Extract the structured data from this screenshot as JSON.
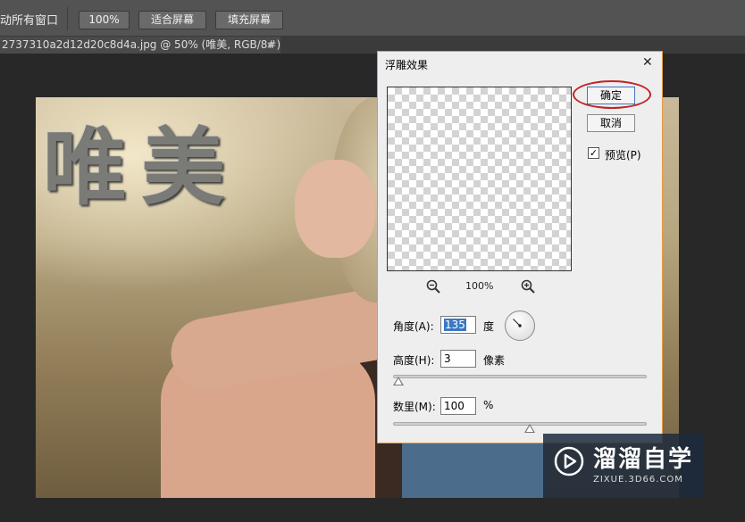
{
  "toolbar": {
    "partial_label": "动所有窗口",
    "zoom_100_label": "100%",
    "fit_screen_label": "适合屏幕",
    "fill_screen_label": "填充屏幕"
  },
  "document_tab": {
    "title": "2737310a2d12d20c8d4a.jpg @ 50% (唯美, RGB/8#) *",
    "close_glyph": "×"
  },
  "canvas": {
    "embossed_text": "唯美"
  },
  "dialog": {
    "title": "浮雕效果",
    "close_glyph": "✕",
    "ok_label": "确定",
    "cancel_label": "取消",
    "preview_checked": true,
    "preview_check_glyph": "✓",
    "preview_label": "预览(P)",
    "zoom_level": "100%",
    "angle_label": "角度(A):",
    "angle_value": "135",
    "angle_unit": "度",
    "height_label": "高度(H):",
    "height_value": "3",
    "height_unit": "像素",
    "amount_label": "数里(M):",
    "amount_value": "100",
    "amount_unit": "%",
    "height_slider_fraction": 0.02,
    "amount_slider_fraction": 0.54
  },
  "watermark": {
    "title": "溜溜自学",
    "url": "ZIXUE.3D66.COM"
  },
  "colors": {
    "highlight": "#c12424",
    "selection": "#3b78c2",
    "dialog_border": "#e09a3c"
  }
}
